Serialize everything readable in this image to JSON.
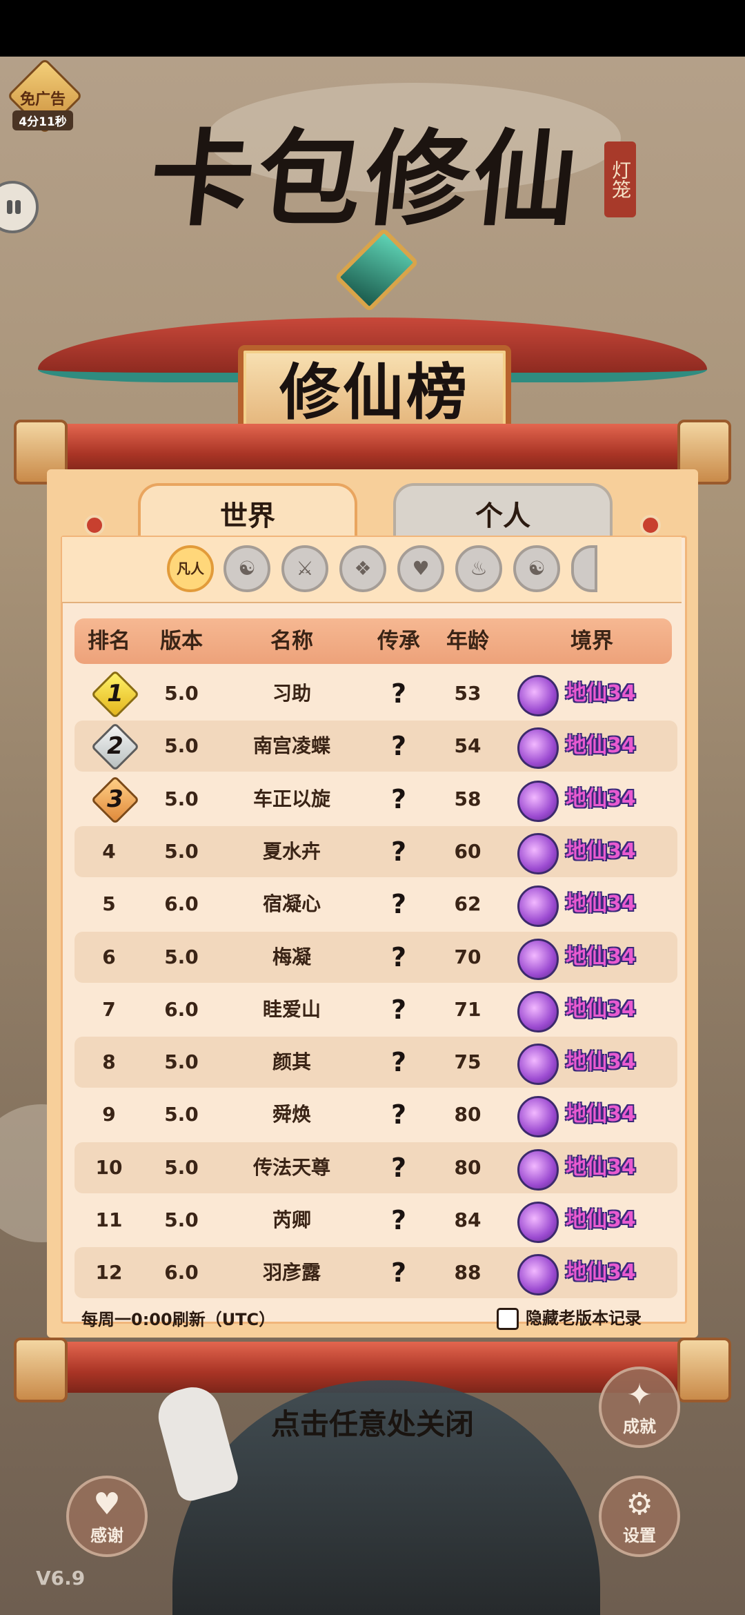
{
  "ad_badge": {
    "label": "免广告",
    "timer": "4分11秒"
  },
  "title": {
    "game_name": "卡包修仙",
    "seal_text": "灯笼",
    "board_name": "修仙榜"
  },
  "tabs": [
    {
      "label": "世界",
      "active": true
    },
    {
      "label": "个人",
      "active": false
    }
  ],
  "realm_filter": {
    "selected_label": "凡人",
    "icons": [
      "yin-yang-icon",
      "fire-icon",
      "heart-icon",
      "book-icon",
      "sword-icon",
      "yin-yang-icon",
      "flame-icon",
      "partial-icon"
    ]
  },
  "table": {
    "headers": [
      "排名",
      "版本",
      "名称",
      "传承",
      "年龄",
      "境界"
    ],
    "rows": [
      {
        "rank": "1",
        "medal": "gold",
        "version": "5.0",
        "name": "习助",
        "inherit": "?",
        "age": "53",
        "realm": "地仙34"
      },
      {
        "rank": "2",
        "medal": "silver",
        "version": "5.0",
        "name": "南宫凌蝶",
        "inherit": "?",
        "age": "54",
        "realm": "地仙34"
      },
      {
        "rank": "3",
        "medal": "bronze",
        "version": "5.0",
        "name": "车正以旋",
        "inherit": "?",
        "age": "58",
        "realm": "地仙34"
      },
      {
        "rank": "4",
        "version": "5.0",
        "name": "夏水卉",
        "inherit": "?",
        "age": "60",
        "realm": "地仙34"
      },
      {
        "rank": "5",
        "version": "6.0",
        "name": "宿凝心",
        "inherit": "?",
        "age": "62",
        "realm": "地仙34"
      },
      {
        "rank": "6",
        "version": "5.0",
        "name": "梅凝",
        "inherit": "?",
        "age": "70",
        "realm": "地仙34"
      },
      {
        "rank": "7",
        "version": "6.0",
        "name": "眭爱山",
        "inherit": "?",
        "age": "71",
        "realm": "地仙34"
      },
      {
        "rank": "8",
        "version": "5.0",
        "name": "颜其",
        "inherit": "?",
        "age": "75",
        "realm": "地仙34"
      },
      {
        "rank": "9",
        "version": "5.0",
        "name": "舜焕",
        "inherit": "?",
        "age": "80",
        "realm": "地仙34"
      },
      {
        "rank": "10",
        "version": "5.0",
        "name": "传法天尊",
        "inherit": "?",
        "age": "80",
        "realm": "地仙34"
      },
      {
        "rank": "11",
        "version": "5.0",
        "name": "芮卿",
        "inherit": "?",
        "age": "84",
        "realm": "地仙34"
      },
      {
        "rank": "12",
        "version": "6.0",
        "name": "羽彦露",
        "inherit": "?",
        "age": "88",
        "realm": "地仙34"
      }
    ]
  },
  "footer": {
    "refresh_note": "每周一0:00刷新（UTC）",
    "hide_old_label": "隐藏老版本记录"
  },
  "close_hint": "点击任意处关闭",
  "buttons": {
    "achievements": "成就",
    "thanks": "感谢",
    "settings": "设置"
  },
  "version": "V6.9",
  "colors": {
    "panel": "#f7cf9a",
    "header_row": "#eda27a",
    "realm_text": "#e85ad0",
    "roof_red": "#c8483a"
  }
}
